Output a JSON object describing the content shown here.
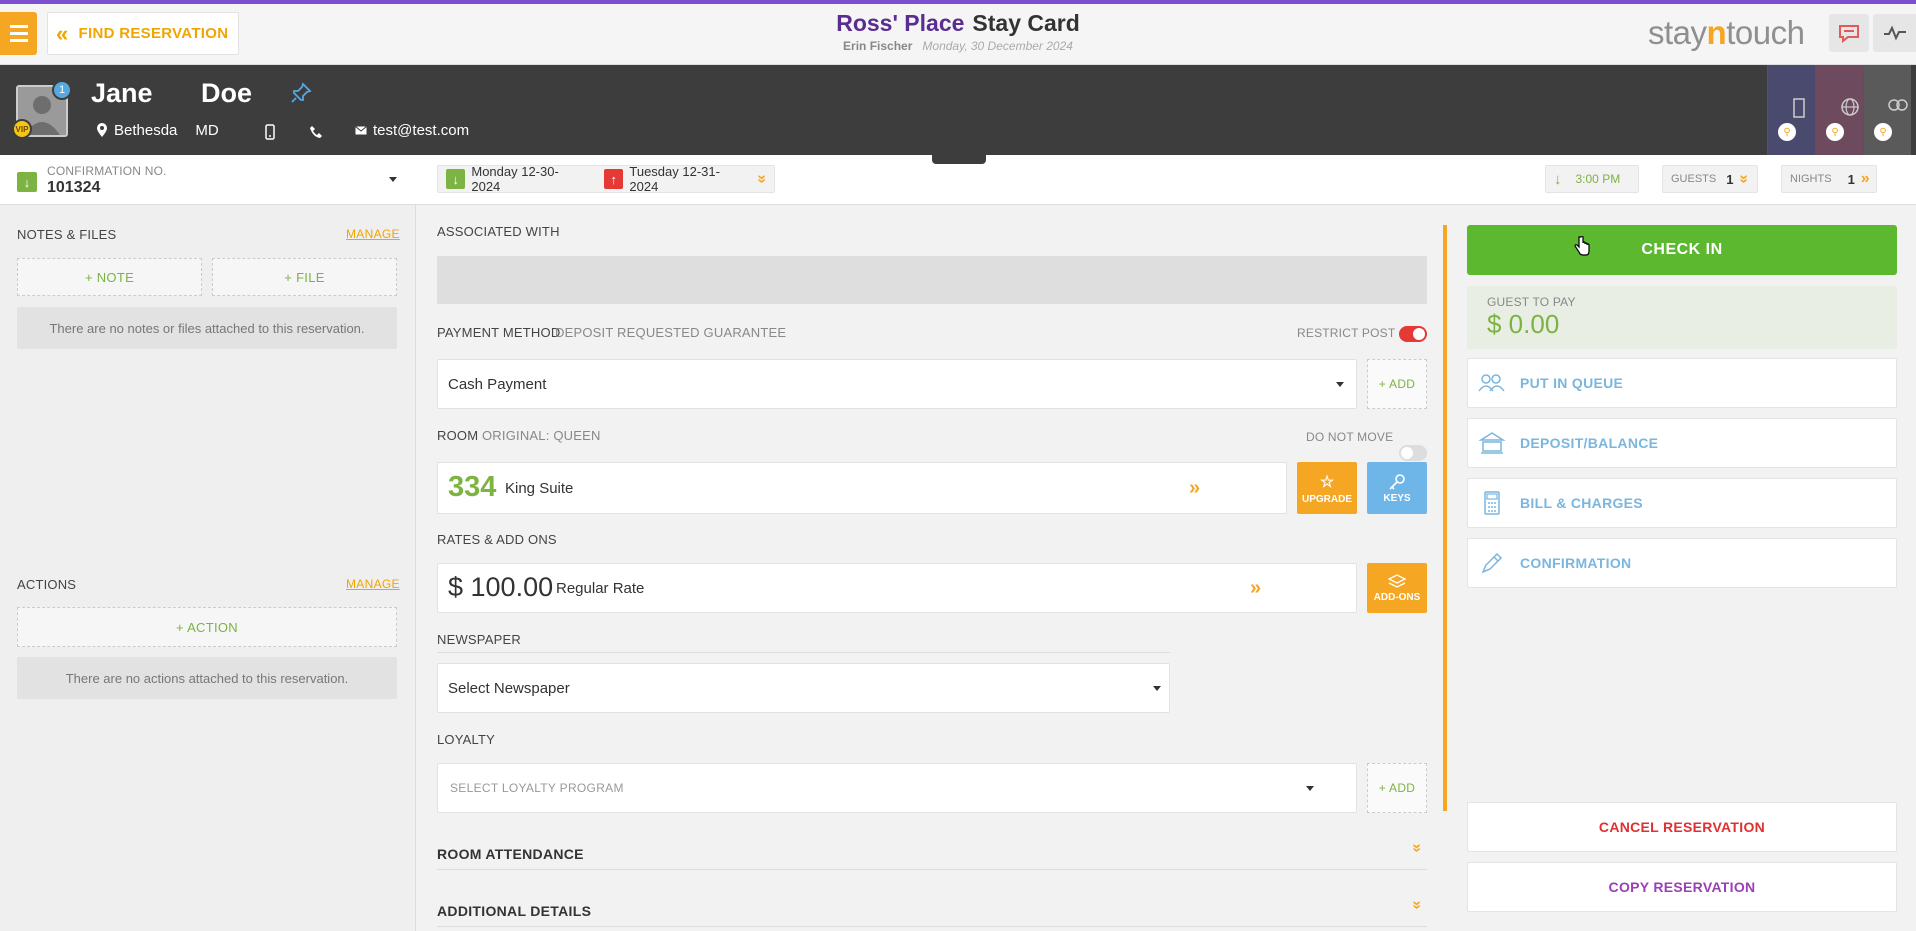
{
  "header": {
    "find_reservation": "FIND RESERVATION",
    "hotel_name": "Ross' Place",
    "page_title": "Stay Card",
    "user_name": "Erin Fischer",
    "business_date": "Monday, 30 December 2024",
    "brand_left": "stay",
    "brand_mid": "n",
    "brand_right": "touch"
  },
  "guest": {
    "first_name": "Jane",
    "last_name": "Doe",
    "badge_count": "1",
    "vip": "VIP",
    "city": "Bethesda",
    "state": "MD",
    "email": "test@test.com"
  },
  "confirmation": {
    "label": "CONFIRMATION NO.",
    "number": "101324"
  },
  "notes": {
    "title": "NOTES & FILES",
    "manage": "MANAGE",
    "add_note": "+ NOTE",
    "add_file": "+ FILE",
    "empty": "There are no notes or files attached to this reservation."
  },
  "actions": {
    "title": "ACTIONS",
    "manage": "MANAGE",
    "add_action": "+ ACTION",
    "empty": "There are no actions attached to this reservation."
  },
  "stay": {
    "arrival": "Monday 12-30-2024",
    "departure": "Tuesday 12-31-2024",
    "eta": "3:00 PM",
    "guests_label": "GUESTS",
    "guests": "1",
    "nights_label": "NIGHTS",
    "nights": "1"
  },
  "details": {
    "associated_with": "ASSOCIATED WITH",
    "payment_method_label": "PAYMENT METHOD",
    "payment_method_type": "DEPOSIT REQUESTED GUARANTEE",
    "restrict_post": "RESTRICT POST",
    "payment_value": "Cash Payment",
    "add": "+ ADD",
    "room_label": "ROOM",
    "room_original": "ORIGINAL: QUEEN",
    "do_not_move": "DO NOT MOVE",
    "room_number": "334",
    "room_type": "King Suite",
    "upgrade": "UPGRADE",
    "keys": "KEYS",
    "rates_label": "RATES & ADD ONS",
    "rate_amount": "$ 100.00",
    "rate_name": "Regular Rate",
    "addons": "ADD-ONS",
    "newspaper_label": "NEWSPAPER",
    "newspaper_value": "Select Newspaper",
    "loyalty_label": "LOYALTY",
    "loyalty_placeholder": "SELECT LOYALTY PROGRAM",
    "loyalty_add": "+ ADD",
    "room_attendance": "ROOM ATTENDANCE",
    "additional_details": "ADDITIONAL DETAILS"
  },
  "right_panel": {
    "check_in": "CHECK IN",
    "guest_to_pay_label": "GUEST TO PAY",
    "guest_to_pay": "$ 0.00",
    "put_in_queue": "PUT IN QUEUE",
    "deposit_balance": "DEPOSIT/BALANCE",
    "bill_charges": "BILL & CHARGES",
    "confirmation": "CONFIRMATION",
    "cancel_reservation": "CANCEL RESERVATION",
    "copy_reservation": "COPY RESERVATION"
  },
  "colors": {
    "accent_orange": "#f5a623",
    "check_in_green": "#5cb82e",
    "hotel_purple": "#5a2d91",
    "cancel_red": "#e03030",
    "copy_purple": "#9b3fb5",
    "action_blue": "#7ab6de"
  }
}
